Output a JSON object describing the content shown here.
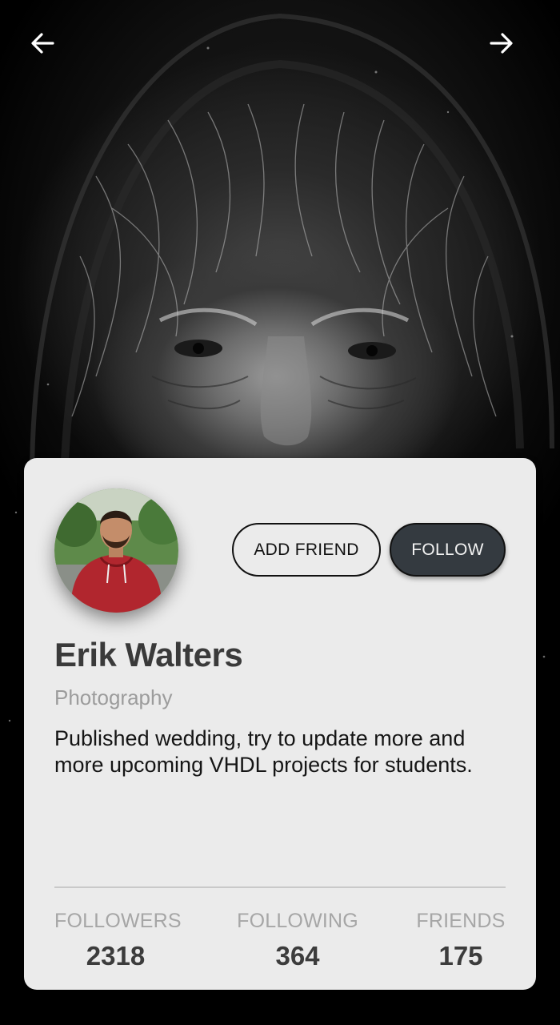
{
  "nav": {
    "back_icon": "arrow-left-icon",
    "forward_icon": "arrow-right-icon"
  },
  "profile": {
    "name": "Erik Walters",
    "category": "Photography",
    "bio": "Published wedding, try to update more and more upcoming VHDL projects for students."
  },
  "actions": {
    "add_friend_label": "ADD FRIEND",
    "follow_label": "FOLLOW"
  },
  "stats": [
    {
      "label": "FOLLOWERS",
      "value": "2318"
    },
    {
      "label": "FOLLOWING",
      "value": "364"
    },
    {
      "label": "FRIENDS",
      "value": "175"
    }
  ],
  "colors": {
    "card_background": "#ebebeb",
    "follow_button": "#343a40",
    "page_background": "#000000"
  }
}
